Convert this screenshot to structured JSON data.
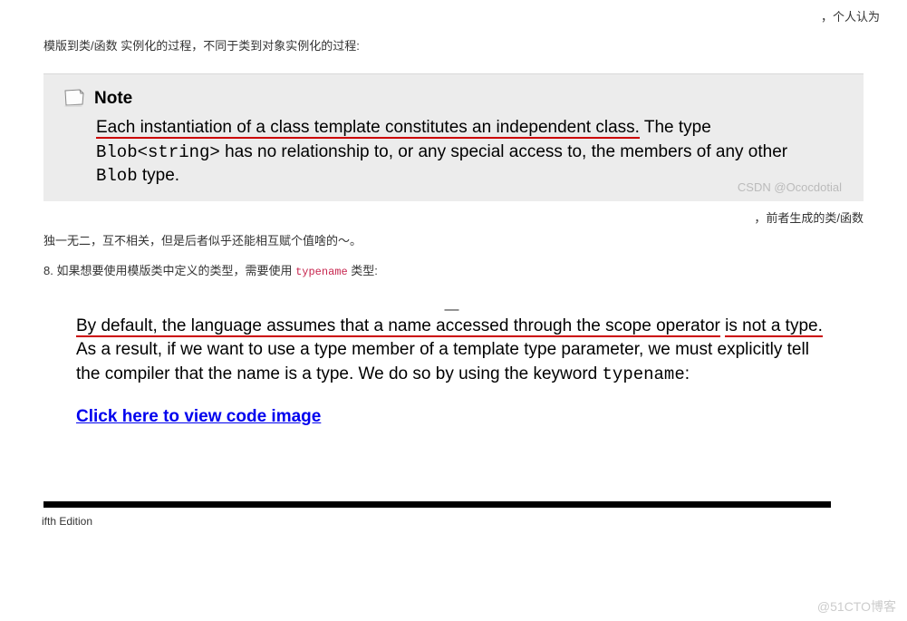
{
  "top_right": "，个人认为",
  "line1": "模版到类/函数 实例化的过程，不同于类到对象实例化的过程:",
  "note": {
    "title": "Note",
    "sentence1_underlined": "Each instantiation of a class template constitutes an independent class.",
    "sentence1_tail": " The type ",
    "code1": "Blob<string>",
    "mid": " has no relationship to, or any special access to, the members of any other ",
    "code2": "Blob",
    "tail": " type.",
    "watermark": "CSDN @Ococdotial"
  },
  "after_note": "，前者生成的类/函数",
  "line2": "独一无二，互不相关，但是后者似乎还能相互赋个值啥的～。",
  "line3_prefix": "8. 如果想要使用模版类中定义的类型，需要使用 ",
  "line3_code": "typename",
  "line3_suffix": " 类型:",
  "excerpt2": {
    "dash": "—",
    "u1": "By default, the language assumes that a name accessed through the scope operator",
    "u2": "is not a type.",
    "rest1": " As a result, if we want to use a type member of a template type parameter, we must explicitly tell the compiler that the name is a type. We do so by using the keyword ",
    "code": "typename",
    "rest2": ":"
  },
  "link": "Click here to view code image",
  "footer": "ifth Edition",
  "bottom_watermark": "@51CTO博客"
}
